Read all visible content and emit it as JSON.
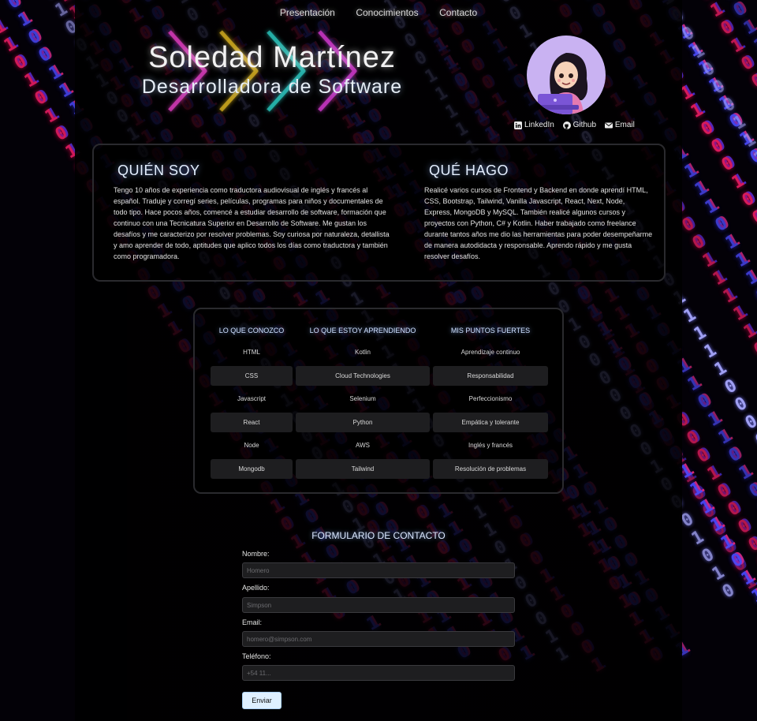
{
  "nav": {
    "items": [
      {
        "label": "Presentación"
      },
      {
        "label": "Conocimientos"
      },
      {
        "label": "Contacto"
      }
    ]
  },
  "header": {
    "name": "Soledad Martínez",
    "role": "Desarrolladora de Software"
  },
  "socials": [
    {
      "label": "LinkedIn",
      "icon": "linkedin-icon"
    },
    {
      "label": "Github",
      "icon": "github-icon"
    },
    {
      "label": "Email",
      "icon": "envelope-icon"
    }
  ],
  "about": {
    "who_title": "QUIÉN SOY",
    "who_text": "Tengo 10 años de experiencia como traductora audiovisual de inglés y francés al español. Traduje y corregí series, películas, programas para niños y documentales de todo tipo. Hace pocos años, comencé a estudiar desarrollo de software, formación que continuo con una Tecnicatura Superior en Desarrollo de Software. Me gustan los desafíos y me caracterizo por resolver problemas. Soy curiosa por naturaleza, detallista y amo aprender de todo, aptitudes que aplico todos los días como traductora y también como programadora.",
    "what_title": "QUÉ HAGO",
    "what_text": "Realicé varios cursos de Frontend y Backend en donde aprendí HTML, CSS, Bootstrap, Tailwind, Vanilla Javascript, React, Next, Node, Express, MongoDB y MySQL. También realicé algunos cursos y proyectos con Python, C# y Kotlin. Haber trabajado como freelance durante tantos años me dio las herramientas para poder desempeñarme de manera autodidacta y responsable. Aprendo rápido y me gusta resolver desafíos."
  },
  "skills": {
    "headers": [
      "LO QUE CONOZCO",
      "LO QUE ESTOY APRENDIENDO",
      "MIS PUNTOS FUERTES"
    ],
    "known": [
      "HTML",
      "CSS",
      "Javascript",
      "React",
      "Node",
      "Mongodb"
    ],
    "learning": [
      "Kotlin",
      "Cloud Technologies",
      "Selenium",
      "Python",
      "AWS",
      "Tailwind"
    ],
    "strengths": [
      "Aprendizaje continuo",
      "Responsabilidad",
      "Perfeccionismo",
      "Empática y tolerante",
      "Inglés y francés",
      "Resolución de problemas"
    ]
  },
  "form": {
    "title": "FORMULARIO DE CONTACTO",
    "fields": [
      {
        "label": "Nombre:",
        "placeholder": "Homero"
      },
      {
        "label": "Apellido:",
        "placeholder": "Simpson"
      },
      {
        "label": "Email:",
        "placeholder": "homero@simpson.com"
      },
      {
        "label": "Teléfono:",
        "placeholder": "+54 11..."
      }
    ],
    "submit_label": "Enviar"
  },
  "colors": {
    "background": "#020104",
    "accent_glow": "#8cb4ff",
    "rain_pink": "#ff1f6a",
    "rain_blue": "#4a4aff",
    "button_bg": "#dff0ff"
  }
}
